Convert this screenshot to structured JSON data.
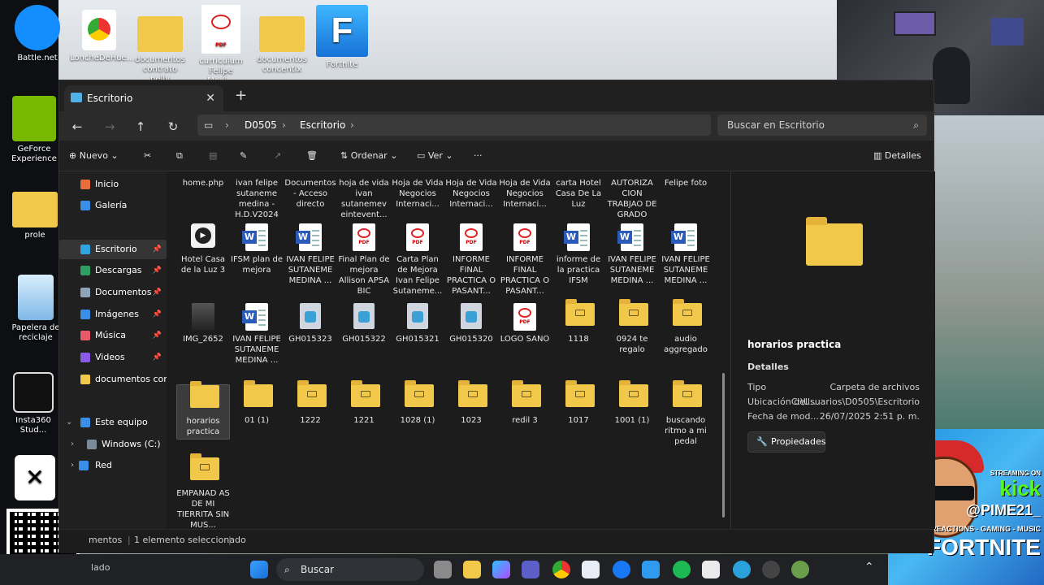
{
  "desktop": {
    "icons": [
      {
        "label": "Battle.net"
      },
      {
        "label": "LoncheDeHue..."
      },
      {
        "label": "documentos contrato nelly"
      },
      {
        "label": "curriculum Felipe Medi..."
      },
      {
        "label": "documentos concentix"
      },
      {
        "label": "Fortnite"
      },
      {
        "label": "GeForce Experience"
      },
      {
        "label": "prole"
      },
      {
        "label": "Papelera de reciclaje"
      },
      {
        "label": "Insta360 Stud..."
      }
    ],
    "stream_overlay": {
      "streaming_on": "STREAMING ON",
      "platform": "kick",
      "handle": "@PIME21_",
      "tagline": "REACTIONS - GAMING - MUSIC",
      "game": "FORTNITE"
    }
  },
  "window": {
    "tab_title": "Escritorio",
    "close_tab": "✕",
    "new_tab": "+",
    "breadcrumb": [
      "D0505",
      "Escritorio"
    ],
    "search_placeholder": "Buscar en Escritorio",
    "toolbar": {
      "new_label": "Nuevo",
      "sort_label": "Ordenar",
      "view_label": "Ver",
      "more_label": "···",
      "details_label": "Detalles"
    },
    "nav": {
      "items": [
        {
          "label": "Inicio",
          "color": "#e86d3a"
        },
        {
          "label": "Galería",
          "color": "#3b8ee8"
        },
        {
          "label": "Escritorio",
          "color": "#2fa4e0"
        },
        {
          "label": "Descargas",
          "color": "#2f9e62"
        },
        {
          "label": "Documentos",
          "color": "#8fa3b8"
        },
        {
          "label": "Imágenes",
          "color": "#3b8ee8"
        },
        {
          "label": "Música",
          "color": "#e85a6a"
        },
        {
          "label": "Videos",
          "color": "#8a5ae8"
        },
        {
          "label": "documentos concen",
          "color": "#f1c84a"
        },
        {
          "label": "Este equipo",
          "color": "#3b8ee8"
        },
        {
          "label": "Windows (C:)",
          "color": "#7a8a9a"
        },
        {
          "label": "Red",
          "color": "#3b8ee8"
        }
      ]
    },
    "files": [
      {
        "name": "home.php",
        "kind": "doc"
      },
      {
        "name": "ivan felipe sutaneme medina -H.D.V2024",
        "kind": "pdf"
      },
      {
        "name": "Documentos - Acceso directo",
        "kind": "doc"
      },
      {
        "name": "hoja de vida ivan sutanemev eintevent...",
        "kind": "pdf"
      },
      {
        "name": "Hoja de Vida Negocios Internaci...",
        "kind": "pdf"
      },
      {
        "name": "Hoja de Vida Negocios Internaci...",
        "kind": "pdf"
      },
      {
        "name": "Hoja de Vida Negocios Internaci...",
        "kind": "pdf"
      },
      {
        "name": "carta Hotel Casa De La Luz",
        "kind": "doc"
      },
      {
        "name": "AUTORIZA CION TRABJAO DE GRADO",
        "kind": "doc"
      },
      {
        "name": "Felipe foto",
        "kind": "img"
      },
      {
        "name": "Hotel Casa de la Luz 3",
        "kind": "video"
      },
      {
        "name": "IFSM plan de mejora",
        "kind": "word"
      },
      {
        "name": "IVAN FELIPE SUTANEME MEDINA ...",
        "kind": "word"
      },
      {
        "name": "Final Plan de mejora Allison APSA BIC",
        "kind": "pdf"
      },
      {
        "name": "Carta Plan de Mejora Ivan Felipe Sutaneme...",
        "kind": "pdf"
      },
      {
        "name": "INFORME FINAL PRACTICA O PASANT...",
        "kind": "pdf"
      },
      {
        "name": "INFORME FINAL PRACTICA O PASANT...",
        "kind": "pdf"
      },
      {
        "name": "informe de la practica IFSM",
        "kind": "word"
      },
      {
        "name": "IVAN FELIPE SUTANEME MEDINA ...",
        "kind": "word"
      },
      {
        "name": "IVAN FELIPE SUTANEME MEDINA ...",
        "kind": "word"
      },
      {
        "name": "IMG_2652",
        "kind": "img"
      },
      {
        "name": "IVAN FELIPE SUTANEME MEDINA ...",
        "kind": "word"
      },
      {
        "name": "GH015323",
        "kind": "gh"
      },
      {
        "name": "GH015322",
        "kind": "gh"
      },
      {
        "name": "GH015321",
        "kind": "gh"
      },
      {
        "name": "GH015320",
        "kind": "gh"
      },
      {
        "name": "LOGO SANO",
        "kind": "pdf"
      },
      {
        "name": "1118",
        "kind": "folder"
      },
      {
        "name": "0924 te regalo",
        "kind": "folder"
      },
      {
        "name": "audio aggregado",
        "kind": "folder"
      },
      {
        "name": "horarios practica",
        "kind": "folder"
      },
      {
        "name": "01 (1)",
        "kind": "folder"
      },
      {
        "name": "1222",
        "kind": "folder"
      },
      {
        "name": "1221",
        "kind": "folder"
      },
      {
        "name": "1028 (1)",
        "kind": "folder"
      },
      {
        "name": "1023",
        "kind": "folder"
      },
      {
        "name": "redil 3",
        "kind": "folder"
      },
      {
        "name": "1017",
        "kind": "folder"
      },
      {
        "name": "1001 (1)",
        "kind": "folder"
      },
      {
        "name": "buscando ritmo a mi pedal",
        "kind": "folder"
      },
      {
        "name": "EMPANAD AS DE MI TIERRITA SIN MUS...",
        "kind": "folder"
      }
    ],
    "details": {
      "title": "horarios practica",
      "section": "Detalles",
      "rows": [
        {
          "k": "Tipo",
          "v": "Carpeta de archivos"
        },
        {
          "k": "Ubicación del...",
          "v": "C:\\Usuarios\\D0505\\Escritorio"
        },
        {
          "k": "Fecha de mod...",
          "v": "26/07/2025 2:51 p. m."
        }
      ],
      "properties_button": "Propiedades"
    },
    "status": {
      "items_text": "mentos",
      "selected_text": "1 elemento seleccionado"
    }
  },
  "taskbar": {
    "search_label": "Buscar",
    "partial_text": "lado"
  }
}
